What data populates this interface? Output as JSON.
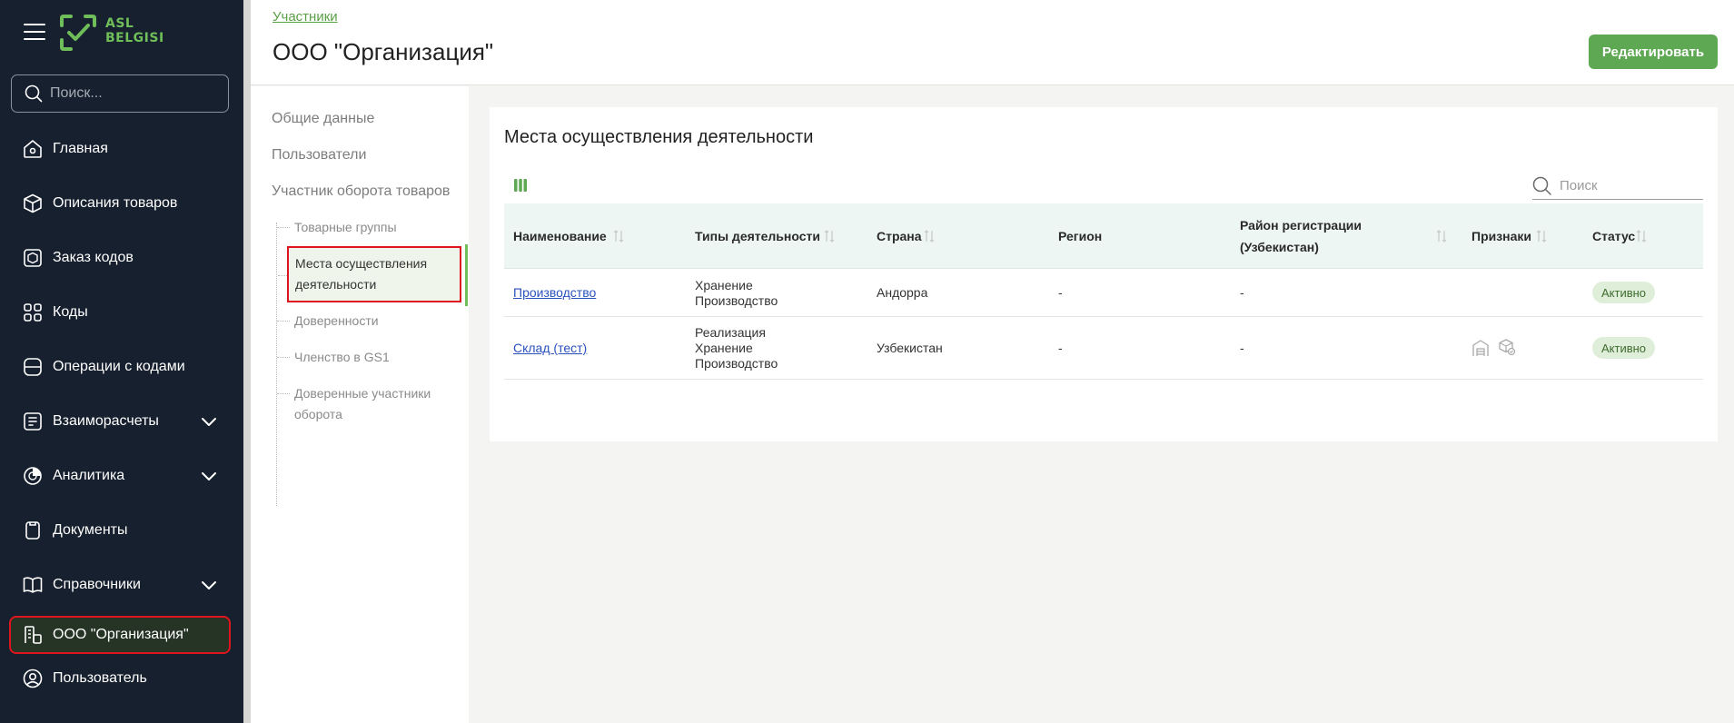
{
  "sidebar": {
    "logo_text_line1": "ASL",
    "logo_text_line2": "BELGISI",
    "search_placeholder": "Поиск...",
    "items": [
      {
        "label": "Главная",
        "icon": "home-icon"
      },
      {
        "label": "Описания товаров",
        "icon": "box-icon"
      },
      {
        "label": "Заказ кодов",
        "icon": "order-box-icon"
      },
      {
        "label": "Коды",
        "icon": "codes-icon"
      },
      {
        "label": "Операции с кодами",
        "icon": "operations-icon"
      },
      {
        "label": "Взаиморасчеты",
        "icon": "settlements-icon",
        "expandable": true
      },
      {
        "label": "Аналитика",
        "icon": "analytics-icon",
        "expandable": true
      },
      {
        "label": "Документы",
        "icon": "documents-icon"
      },
      {
        "label": "Справочники",
        "icon": "book-icon",
        "expandable": true
      },
      {
        "label": "ООО \"Организация\"",
        "icon": "organization-icon",
        "active": true
      },
      {
        "label": "Пользователь",
        "icon": "user-icon"
      }
    ]
  },
  "header": {
    "breadcrumb": "Участники",
    "title": "ООО \"Организация\"",
    "edit_button": "Редактировать"
  },
  "submenu": {
    "general": "Общие данные",
    "users": "Пользователи",
    "participant": "Участник оборота товаров",
    "sub_items": [
      {
        "label": "Товарные группы"
      },
      {
        "label": "Места осуществления деятельности",
        "active": true
      },
      {
        "label": "Доверенности"
      },
      {
        "label": "Членство в GS1"
      },
      {
        "label": "Доверенные участники оборота"
      }
    ]
  },
  "card": {
    "title": "Места осуществления деятельности",
    "search_placeholder": "Поиск",
    "columns": {
      "name": "Наименование",
      "types": "Типы деятельности",
      "country": "Страна",
      "region": "Регион",
      "district_line1": "Район регистрации",
      "district_line2": "(Узбекистан)",
      "signs": "Признаки",
      "status": "Статус"
    },
    "rows": [
      {
        "name": "Производство",
        "types": [
          "Хранение",
          "Производство"
        ],
        "country": "Андорра",
        "region": "-",
        "district": "-",
        "status": "Активно"
      },
      {
        "name": "Склад (тест)",
        "types": [
          "Реализация",
          "Хранение",
          "Производство"
        ],
        "country": "Узбекистан",
        "region": "-",
        "district": "-",
        "signs": [
          "warehouse-icon",
          "package-check-icon"
        ],
        "status": "Активно"
      }
    ]
  },
  "colors": {
    "sidebar_bg": "#17202e",
    "accent_green": "#5ea853",
    "highlight_red": "#e0141e",
    "status_badge_bg": "#dfeed8"
  }
}
